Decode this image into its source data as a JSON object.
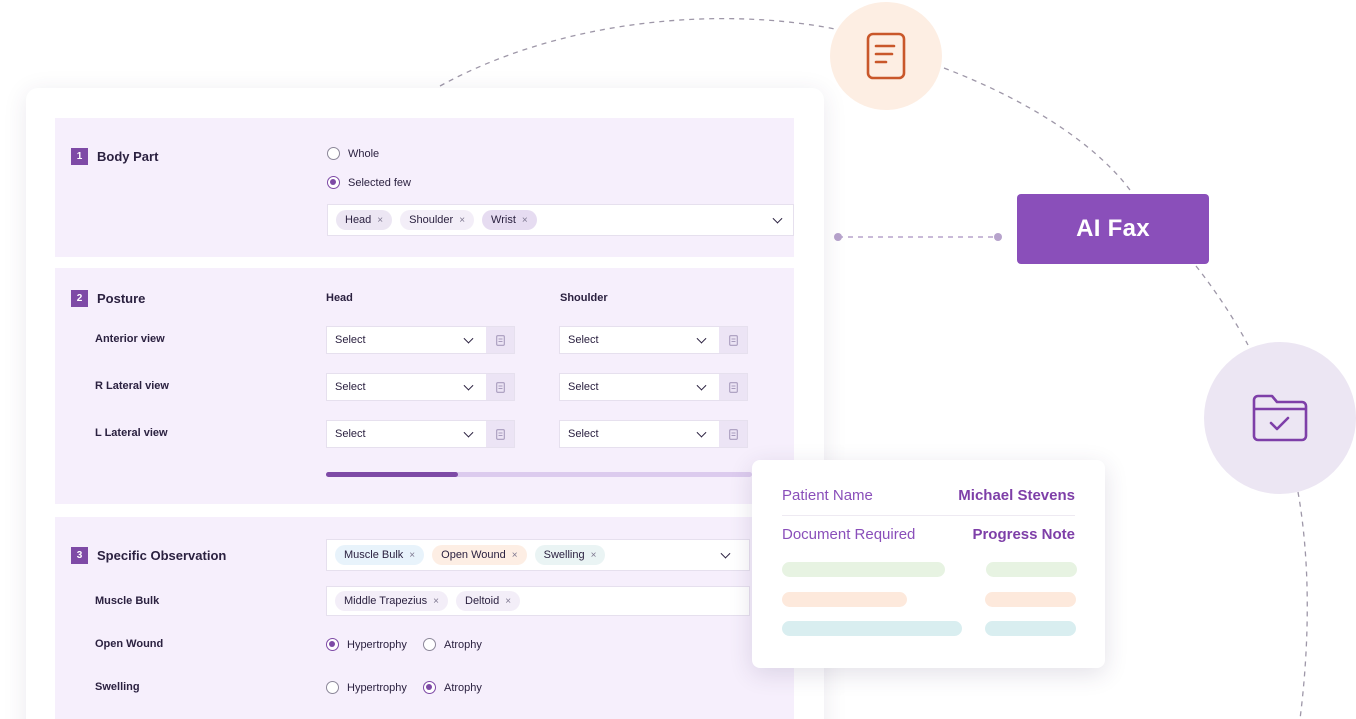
{
  "ai_fax": {
    "label": "AI Fax"
  },
  "section1": {
    "number": "1",
    "title": "Body Part",
    "options": [
      {
        "label": "Whole",
        "checked": false
      },
      {
        "label": "Selected few",
        "checked": true
      }
    ],
    "chips": [
      "Head",
      "Shoulder",
      "Wrist"
    ]
  },
  "section2": {
    "number": "2",
    "title": "Posture",
    "columns": [
      "Head",
      "Shoulder"
    ],
    "rows": [
      "Anterior view",
      "R Lateral view",
      "L Lateral view"
    ],
    "select_placeholder": "Select",
    "progress_fraction": 0.31
  },
  "section3": {
    "number": "3",
    "title": "Specific Observation",
    "chips": [
      "Muscle Bulk",
      "Open Wound",
      "Swelling"
    ],
    "muscle_bulk": {
      "label": "Muscle Bulk",
      "chips": [
        "Middle Trapezius",
        "Deltoid"
      ]
    },
    "open_wound": {
      "label": "Open Wound",
      "options": [
        {
          "label": "Hypertrophy",
          "checked": true
        },
        {
          "label": "Atrophy",
          "checked": false
        }
      ]
    },
    "swelling": {
      "label": "Swelling",
      "options": [
        {
          "label": "Hypertrophy",
          "checked": false
        },
        {
          "label": "Atrophy",
          "checked": true
        }
      ]
    }
  },
  "info_card": {
    "patient_name_label": "Patient Name",
    "patient_name_value": "Michael Stevens",
    "document_label": "Document Required",
    "document_value": "Progress Note"
  },
  "colors": {
    "accent": "#8a4fba",
    "panel_bg": "#f6effc",
    "chip_head": "#ece6f3",
    "chip_shoulder": "#f3eef8",
    "chip_wrist": "#e6dcf1",
    "chip_muscle": "#e8f3fb",
    "chip_wound": "#fdeee4",
    "chip_swelling": "#eaf4f4",
    "bar_green": "#e7f3e2",
    "bar_orange": "#fde9dc",
    "bar_teal": "#d9eef0"
  },
  "icons": [
    "document-icon",
    "folder-check-icon",
    "doc-small-icon",
    "chevron-down-icon",
    "close-icon"
  ]
}
